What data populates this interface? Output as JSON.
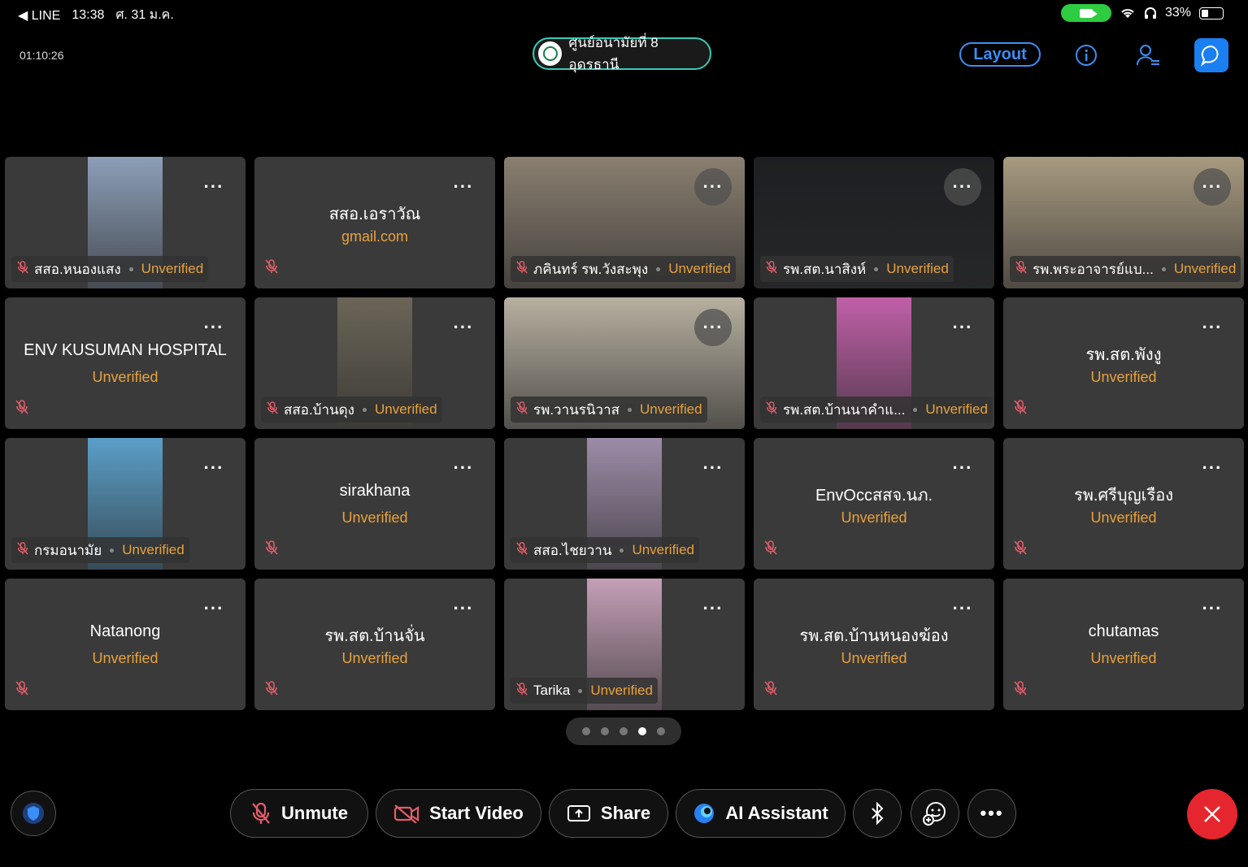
{
  "status_bar": {
    "back_app": "◀ LINE",
    "time": "13:38",
    "date": "ศ. 31 ม.ค.",
    "battery": "33%"
  },
  "header": {
    "elapsed": "01:10:26",
    "meeting_name": "ศูนย์อนามัยที่ 8 อุดรธานี",
    "layout_label": "Layout"
  },
  "colors": {
    "accent": "#3a8ef6",
    "unverified": "#e8a23c",
    "leave": "#e5262e",
    "muted_mic": "#e35d6a"
  },
  "participants": [
    {
      "name": "สสอ.หนองแสง",
      "status": "Unverified",
      "video": "narrow",
      "bg": "#8c9fb8"
    },
    {
      "name": "สสอ.เอราวัณ",
      "status": "gmail.com",
      "video": "none"
    },
    {
      "name": "ภคินทร์ รพ.วังสะพุง",
      "status": "Unverified",
      "video": "full",
      "bg": "#8a7f70"
    },
    {
      "name": "รพ.สต.นาสิงห์",
      "status": "Unverified",
      "video": "full",
      "bg": "#1d1f22"
    },
    {
      "name": "รพ.พระอาจารย์แบ...",
      "status": "Unverified",
      "video": "full",
      "bg": "#a89a80"
    },
    {
      "name": "ENV KUSUMAN HOSPITAL",
      "status": "Unverified",
      "video": "none"
    },
    {
      "name": "สสอ.บ้านดุง",
      "status": "Unverified",
      "video": "narrow",
      "bg": "#6b6558"
    },
    {
      "name": "รพ.วานรนิวาส",
      "status": "Unverified",
      "video": "full",
      "bg": "#b7b0a0"
    },
    {
      "name": "รพ.สต.บ้านนาคำแ...",
      "status": "Unverified",
      "video": "narrow",
      "bg": "#c060a8"
    },
    {
      "name": "รพ.สต.พังงู",
      "status": "Unverified",
      "video": "none"
    },
    {
      "name": "กรมอนามัย",
      "status": "Unverified",
      "video": "narrow",
      "bg": "#5a9fc8"
    },
    {
      "name": "sirakhana",
      "status": "Unverified",
      "video": "none"
    },
    {
      "name": "สสอ.ไชยวาน",
      "status": "Unverified",
      "video": "narrow",
      "bg": "#9d8ca8"
    },
    {
      "name": "EnvOccสสจ.นภ.",
      "status": "Unverified",
      "video": "none"
    },
    {
      "name": "รพ.ศรีบุญเรือง",
      "status": "Unverified",
      "video": "none"
    },
    {
      "name": "Natanong",
      "status": "Unverified",
      "video": "none"
    },
    {
      "name": "รพ.สต.บ้านจั่น",
      "status": "Unverified",
      "video": "none"
    },
    {
      "name": "Tarika",
      "status": "Unverified",
      "video": "narrow",
      "bg": "#c4a0b6"
    },
    {
      "name": "รพ.สต.บ้านหนองฆ้อง",
      "status": "Unverified",
      "video": "none"
    },
    {
      "name": "chutamas",
      "status": "Unverified",
      "video": "none"
    }
  ],
  "pager": {
    "count": 5,
    "active": 4
  },
  "toolbar": {
    "unmute": "Unmute",
    "start_video": "Start Video",
    "share": "Share",
    "ai_assistant": "AI Assistant"
  },
  "icons": {
    "more": "more-dots-icon",
    "mic_muted": "mic-muted-icon",
    "shield": "shield-icon",
    "bluetooth": "bluetooth-icon",
    "reaction": "reaction-icon",
    "close": "close-icon",
    "info": "info-icon",
    "participants": "participants-icon",
    "chat": "chat-icon"
  }
}
